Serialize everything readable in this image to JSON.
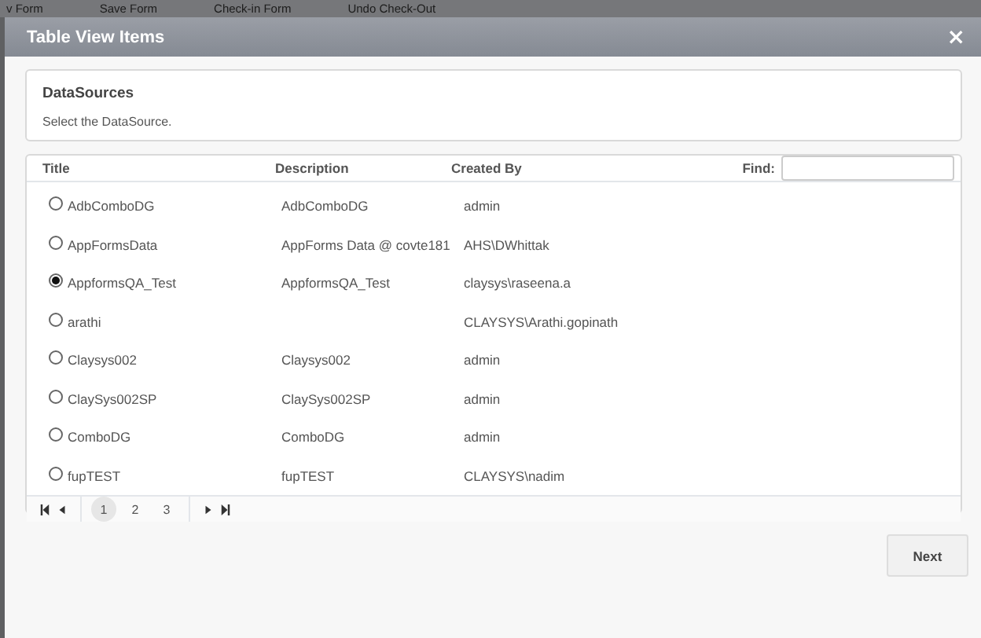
{
  "background_toolbar": [
    "v Form",
    "Save Form",
    "Check-in Form",
    "Undo Check-Out"
  ],
  "window": {
    "title": "Table View Items",
    "close": "×"
  },
  "section": {
    "title": "DataSources",
    "hint": "Select the DataSource."
  },
  "table": {
    "columns": [
      "Title",
      "Description",
      "Created By"
    ],
    "find_label": "Find:",
    "rows": [
      {
        "title": "AdbComboDG",
        "description": "AdbComboDG",
        "created_by": "admin",
        "selected": false
      },
      {
        "title": "AppFormsData",
        "description": "AppForms Data @ covte181",
        "created_by": "AHS\\DWhittak",
        "selected": false
      },
      {
        "title": "AppformsQA_Test",
        "description": "AppformsQA_Test",
        "created_by": "claysys\\raseena.a",
        "selected": true
      },
      {
        "title": "arathi",
        "description": "",
        "created_by": "CLAYSYS\\Arathi.gopinath",
        "selected": false
      },
      {
        "title": "Claysys002",
        "description": "Claysys002",
        "created_by": "admin",
        "selected": false
      },
      {
        "title": "ClaySys002SP",
        "description": "ClaySys002SP",
        "created_by": "admin",
        "selected": false
      },
      {
        "title": "ComboDG",
        "description": "ComboDG",
        "created_by": "admin",
        "selected": false
      },
      {
        "title": "fupTEST",
        "description": "fupTEST",
        "created_by": "CLAYSYS\\nadim",
        "selected": false
      }
    ]
  },
  "pager": {
    "pages": [
      {
        "label": "1",
        "selected": true
      },
      {
        "label": "2",
        "selected": false
      },
      {
        "label": "3",
        "selected": false
      }
    ]
  },
  "buttons": [
    "Next"
  ]
}
